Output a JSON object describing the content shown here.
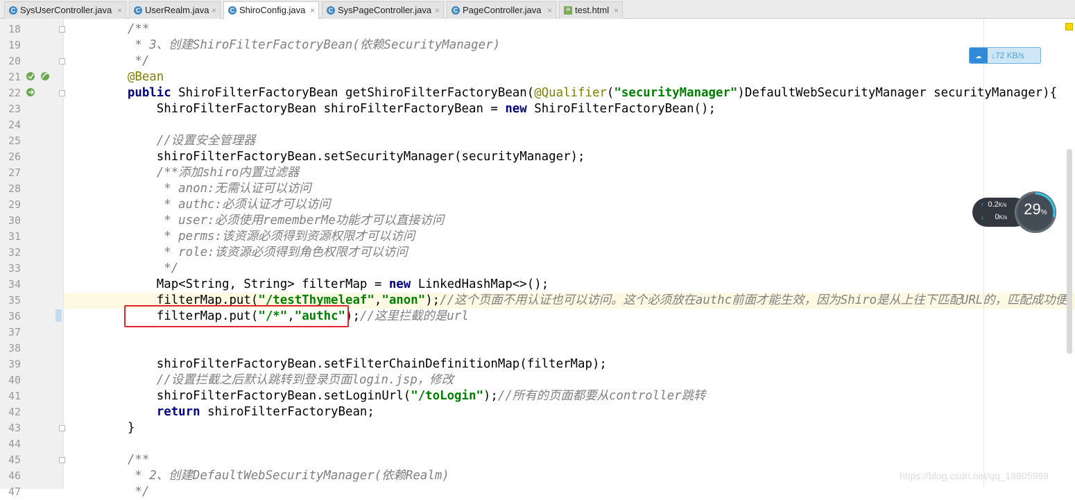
{
  "tabs": [
    {
      "label": "SysUserController.java",
      "icon": "c",
      "active": false
    },
    {
      "label": "UserRealm.java",
      "icon": "c",
      "active": false
    },
    {
      "label": "ShiroConfig.java",
      "icon": "c",
      "active": true
    },
    {
      "label": "SysPageController.java",
      "icon": "c",
      "active": false
    },
    {
      "label": "PageController.java",
      "icon": "c",
      "active": false
    },
    {
      "label": "test.html",
      "icon": "html",
      "active": false
    }
  ],
  "close_glyph": "×",
  "lines": [
    {
      "n": "18",
      "fold": true,
      "tokens": [
        [
          "cm",
          "    /**"
        ]
      ]
    },
    {
      "n": "19",
      "tokens": [
        [
          "cm",
          "     * 3、创建ShiroFilterFactoryBean(依赖SecurityManager)"
        ]
      ]
    },
    {
      "n": "20",
      "fold": true,
      "tokens": [
        [
          "cm",
          "     */"
        ]
      ]
    },
    {
      "n": "21",
      "tokens": [
        [
          "an",
          "    @Bean"
        ]
      ]
    },
    {
      "n": "22",
      "fold": true,
      "tokens": [
        [
          "kw",
          "    public "
        ],
        [
          "",
          "ShiroFilterFactoryBean getShiroFilterFactoryBean("
        ],
        [
          "an",
          "@Qualifier"
        ],
        [
          "",
          "("
        ],
        [
          "st",
          "\"securityManager\""
        ],
        [
          "",
          ")DefaultWebSecurityManager securityManager){"
        ]
      ]
    },
    {
      "n": "23",
      "tokens": [
        [
          "",
          "        ShiroFilterFactoryBean shiroFilterFactoryBean = "
        ],
        [
          "kw",
          "new "
        ],
        [
          "",
          "ShiroFilterFactoryBean();"
        ]
      ]
    },
    {
      "n": "24",
      "tokens": []
    },
    {
      "n": "25",
      "tokens": [
        [
          "cm",
          "        //设置安全管理器"
        ]
      ]
    },
    {
      "n": "26",
      "tokens": [
        [
          "",
          "        shiroFilterFactoryBean.setSecurityManager(securityManager);"
        ]
      ]
    },
    {
      "n": "27",
      "tokens": [
        [
          "cm",
          "        /**添加shiro内置过滤器"
        ]
      ]
    },
    {
      "n": "28",
      "tokens": [
        [
          "cm",
          "         * anon:无需认证可以访问"
        ]
      ]
    },
    {
      "n": "29",
      "tokens": [
        [
          "cm",
          "         * authc:必须认证才可以访问"
        ]
      ]
    },
    {
      "n": "30",
      "tokens": [
        [
          "cm",
          "         * user:必须使用rememberMe功能才可以直接访问"
        ]
      ]
    },
    {
      "n": "31",
      "tokens": [
        [
          "cm",
          "         * perms:该资源必须得到资源权限才可以访问"
        ]
      ]
    },
    {
      "n": "32",
      "tokens": [
        [
          "cm",
          "         * role:该资源必须得到角色权限才可以访问"
        ]
      ]
    },
    {
      "n": "33",
      "tokens": [
        [
          "cm",
          "         */"
        ]
      ]
    },
    {
      "n": "34",
      "tokens": [
        [
          "",
          "        Map<String, String> filterMap = "
        ],
        [
          "kw",
          "new "
        ],
        [
          "",
          "LinkedHashMap<>();"
        ]
      ]
    },
    {
      "n": "35",
      "hl": true,
      "tokens": [
        [
          "",
          "        filterMap.put("
        ],
        [
          "st",
          "\"/testThymeleaf\""
        ],
        [
          "",
          ","
        ],
        [
          "st",
          "\"anon\""
        ],
        [
          "",
          ");"
        ],
        [
          "cm",
          "//这个页面不用认证也可以访问。这个必须放在authc前面才能生效，因为Shiro是从上往下匹配URL的，匹配成功便"
        ]
      ]
    },
    {
      "n": "36",
      "tokens": [
        [
          "",
          "        filterMap.put("
        ],
        [
          "st",
          "\"/*\""
        ],
        [
          "",
          ","
        ],
        [
          "st",
          "\"authc\""
        ],
        [
          "",
          ");"
        ],
        [
          "cm",
          "//这里拦截的是url"
        ]
      ]
    },
    {
      "n": "37",
      "tokens": []
    },
    {
      "n": "38",
      "tokens": []
    },
    {
      "n": "39",
      "tokens": [
        [
          "",
          "        shiroFilterFactoryBean.setFilterChainDefinitionMap(filterMap);"
        ]
      ]
    },
    {
      "n": "40",
      "tokens": [
        [
          "cm",
          "        //设置拦截之后默认跳转到登录页面login.jsp，修改"
        ]
      ]
    },
    {
      "n": "41",
      "tokens": [
        [
          "",
          "        shiroFilterFactoryBean.setLoginUrl("
        ],
        [
          "st",
          "\"/toLogin\""
        ],
        [
          "",
          ");"
        ],
        [
          "cm",
          "//所有的页面都要从controller跳转"
        ]
      ]
    },
    {
      "n": "42",
      "tokens": [
        [
          "kw",
          "        return "
        ],
        [
          "",
          "shiroFilterFactoryBean;"
        ]
      ]
    },
    {
      "n": "43",
      "fold": true,
      "tokens": [
        [
          "",
          "    }"
        ]
      ]
    },
    {
      "n": "44",
      "tokens": []
    },
    {
      "n": "45",
      "fold": true,
      "tokens": [
        [
          "cm",
          "    /**"
        ]
      ]
    },
    {
      "n": "46",
      "tokens": [
        [
          "cm",
          "     * 2、创建DefaultWebSecurityManager(依赖Realm)"
        ]
      ]
    },
    {
      "n": "47",
      "tokens": [
        [
          "cm",
          "     */"
        ]
      ]
    }
  ],
  "net_badge": {
    "speed": "↓72 KB/s",
    "icon": "cloud-icon"
  },
  "net_widget": {
    "up": "0.2",
    "up_unit": "K/s",
    "down": "0",
    "down_unit": "K/s",
    "percent": "29",
    "percent_sign": "%",
    "level": 0.29
  },
  "watermark": "https://blog.csdn.net/qq_18605969",
  "colors": {
    "keyword": "#000080",
    "annotation": "#808000",
    "string": "#008000",
    "comment": "#808080",
    "highlight_box": "#e4222a"
  }
}
